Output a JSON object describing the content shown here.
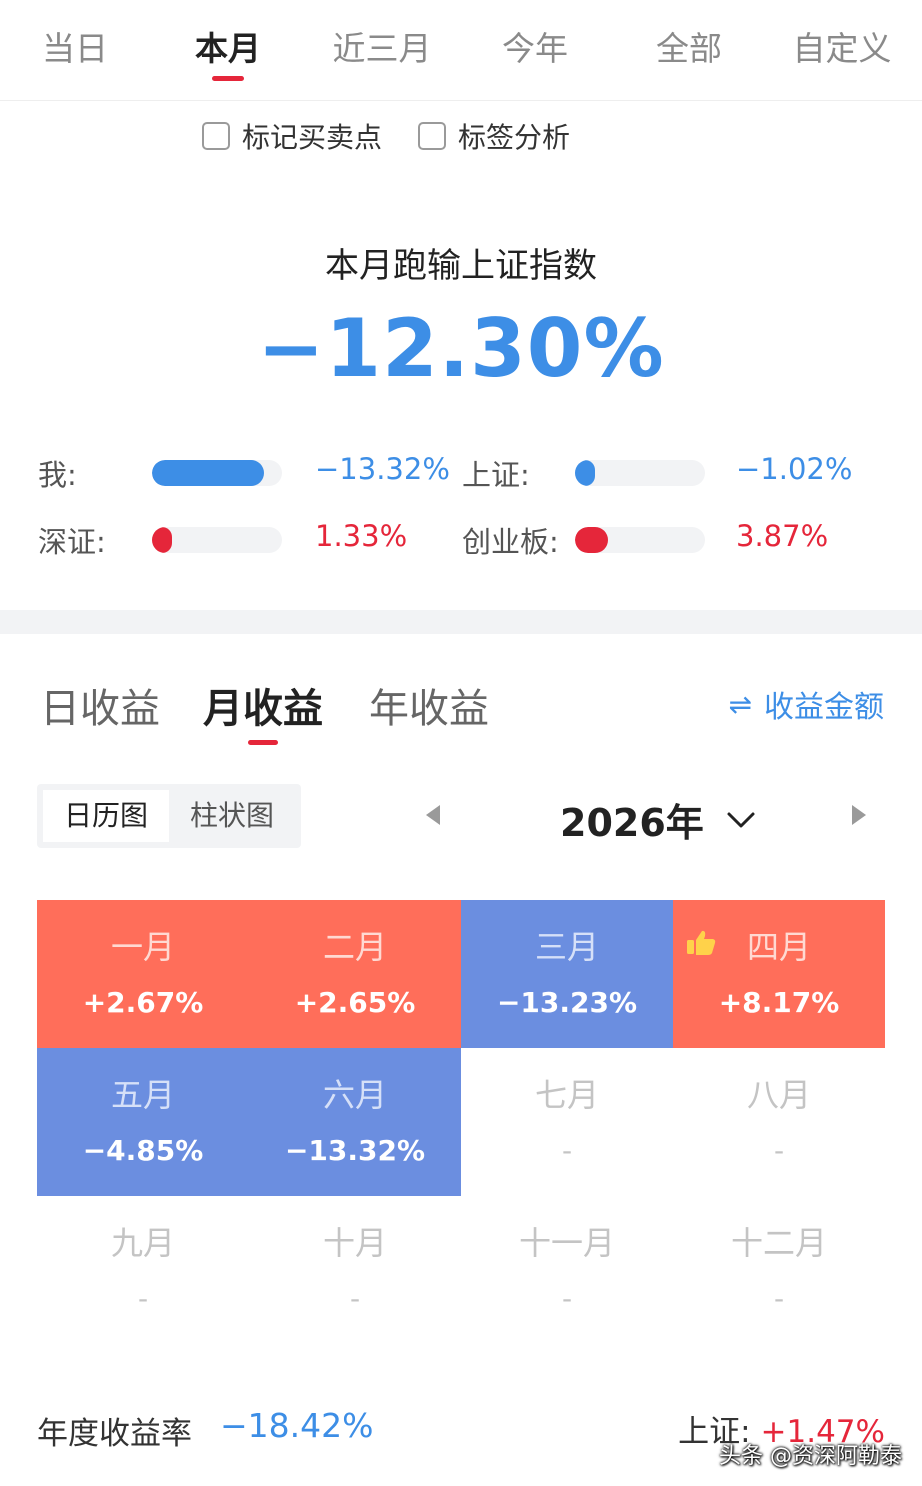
{
  "period_tabs": [
    {
      "label": "当日",
      "active": false
    },
    {
      "label": "本月",
      "active": true
    },
    {
      "label": "近三月",
      "active": false
    },
    {
      "label": "今年",
      "active": false
    },
    {
      "label": "全部",
      "active": false
    },
    {
      "label": "自定义",
      "active": false
    }
  ],
  "options": {
    "mark_trades": {
      "label": "标记买卖点",
      "checked": false
    },
    "tag_analysis": {
      "label": "标签分析",
      "checked": false
    }
  },
  "summary": {
    "title": "本月跑输上证指数",
    "value": "−12.30%"
  },
  "comparison": [
    {
      "label": "我:",
      "value": "−13.32%",
      "level": 0.86,
      "direction": "negative"
    },
    {
      "label": "上证:",
      "value": "−1.02%",
      "level": 0.07,
      "direction": "negative"
    },
    {
      "label": "深证:",
      "value": "1.33%",
      "level": 0.09,
      "direction": "positive"
    },
    {
      "label": "创业板:",
      "value": "3.87%",
      "level": 0.25,
      "direction": "positive"
    }
  ],
  "income_tabs": [
    {
      "label": "日收益",
      "active": false
    },
    {
      "label": "月收益",
      "active": true
    },
    {
      "label": "年收益",
      "active": false
    }
  ],
  "amount_toggle": {
    "icon": "swap-arrows-icon",
    "label": "收益金额"
  },
  "view_switch": {
    "calendar": "日历图",
    "bar": "柱状图",
    "active": "calendar"
  },
  "year": "2026年",
  "months": [
    {
      "name": "一月",
      "value": "+2.67%",
      "state": "up",
      "best": false
    },
    {
      "name": "二月",
      "value": "+2.65%",
      "state": "up",
      "best": false
    },
    {
      "name": "三月",
      "value": "−13.23%",
      "state": "down",
      "best": false
    },
    {
      "name": "四月",
      "value": "+8.17%",
      "state": "up",
      "best": true
    },
    {
      "name": "五月",
      "value": "−4.85%",
      "state": "down",
      "best": false
    },
    {
      "name": "六月",
      "value": "−13.32%",
      "state": "down",
      "best": false
    },
    {
      "name": "七月",
      "value": "-",
      "state": "empty",
      "best": false
    },
    {
      "name": "八月",
      "value": "-",
      "state": "empty",
      "best": false
    },
    {
      "name": "九月",
      "value": "-",
      "state": "empty",
      "best": false
    },
    {
      "name": "十月",
      "value": "-",
      "state": "empty",
      "best": false
    },
    {
      "name": "十一月",
      "value": "-",
      "state": "empty",
      "best": false
    },
    {
      "name": "十二月",
      "value": "-",
      "state": "empty",
      "best": false
    }
  ],
  "footer": {
    "annual_label": "年度收益率",
    "annual_value": "−18.42%",
    "index_label": "上证:",
    "index_value": "+1.47%"
  },
  "watermark": "头条 @资深阿勒泰",
  "colors": {
    "accent_red": "#e5263a",
    "accent_blue": "#3d8ee6",
    "cell_up": "#ff6e5a",
    "cell_down": "#6b8ee0"
  }
}
